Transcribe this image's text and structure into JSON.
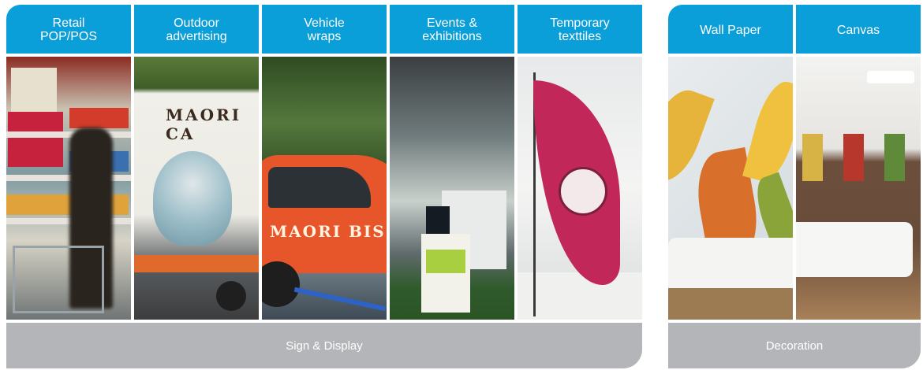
{
  "sign_display": {
    "tabs": [
      {
        "label": "Retail\nPOP/POS"
      },
      {
        "label": "Outdoor\nadvertising"
      },
      {
        "label": "Vehicle\nwraps"
      },
      {
        "label": "Events &\nexhibitions"
      },
      {
        "label": "Temporary\ntexttiles"
      }
    ],
    "photo_texts": {
      "outdoor_truck": "MAORI CA",
      "vehicle_van": "MAORI BIS"
    },
    "footer": "Sign & Display"
  },
  "decoration": {
    "tabs": [
      {
        "label": "Wall Paper"
      },
      {
        "label": "Canvas"
      }
    ],
    "footer": "Decoration"
  },
  "colors": {
    "tab_blue": "#0a9fd8",
    "footer_gray": "#b3b5b8"
  }
}
